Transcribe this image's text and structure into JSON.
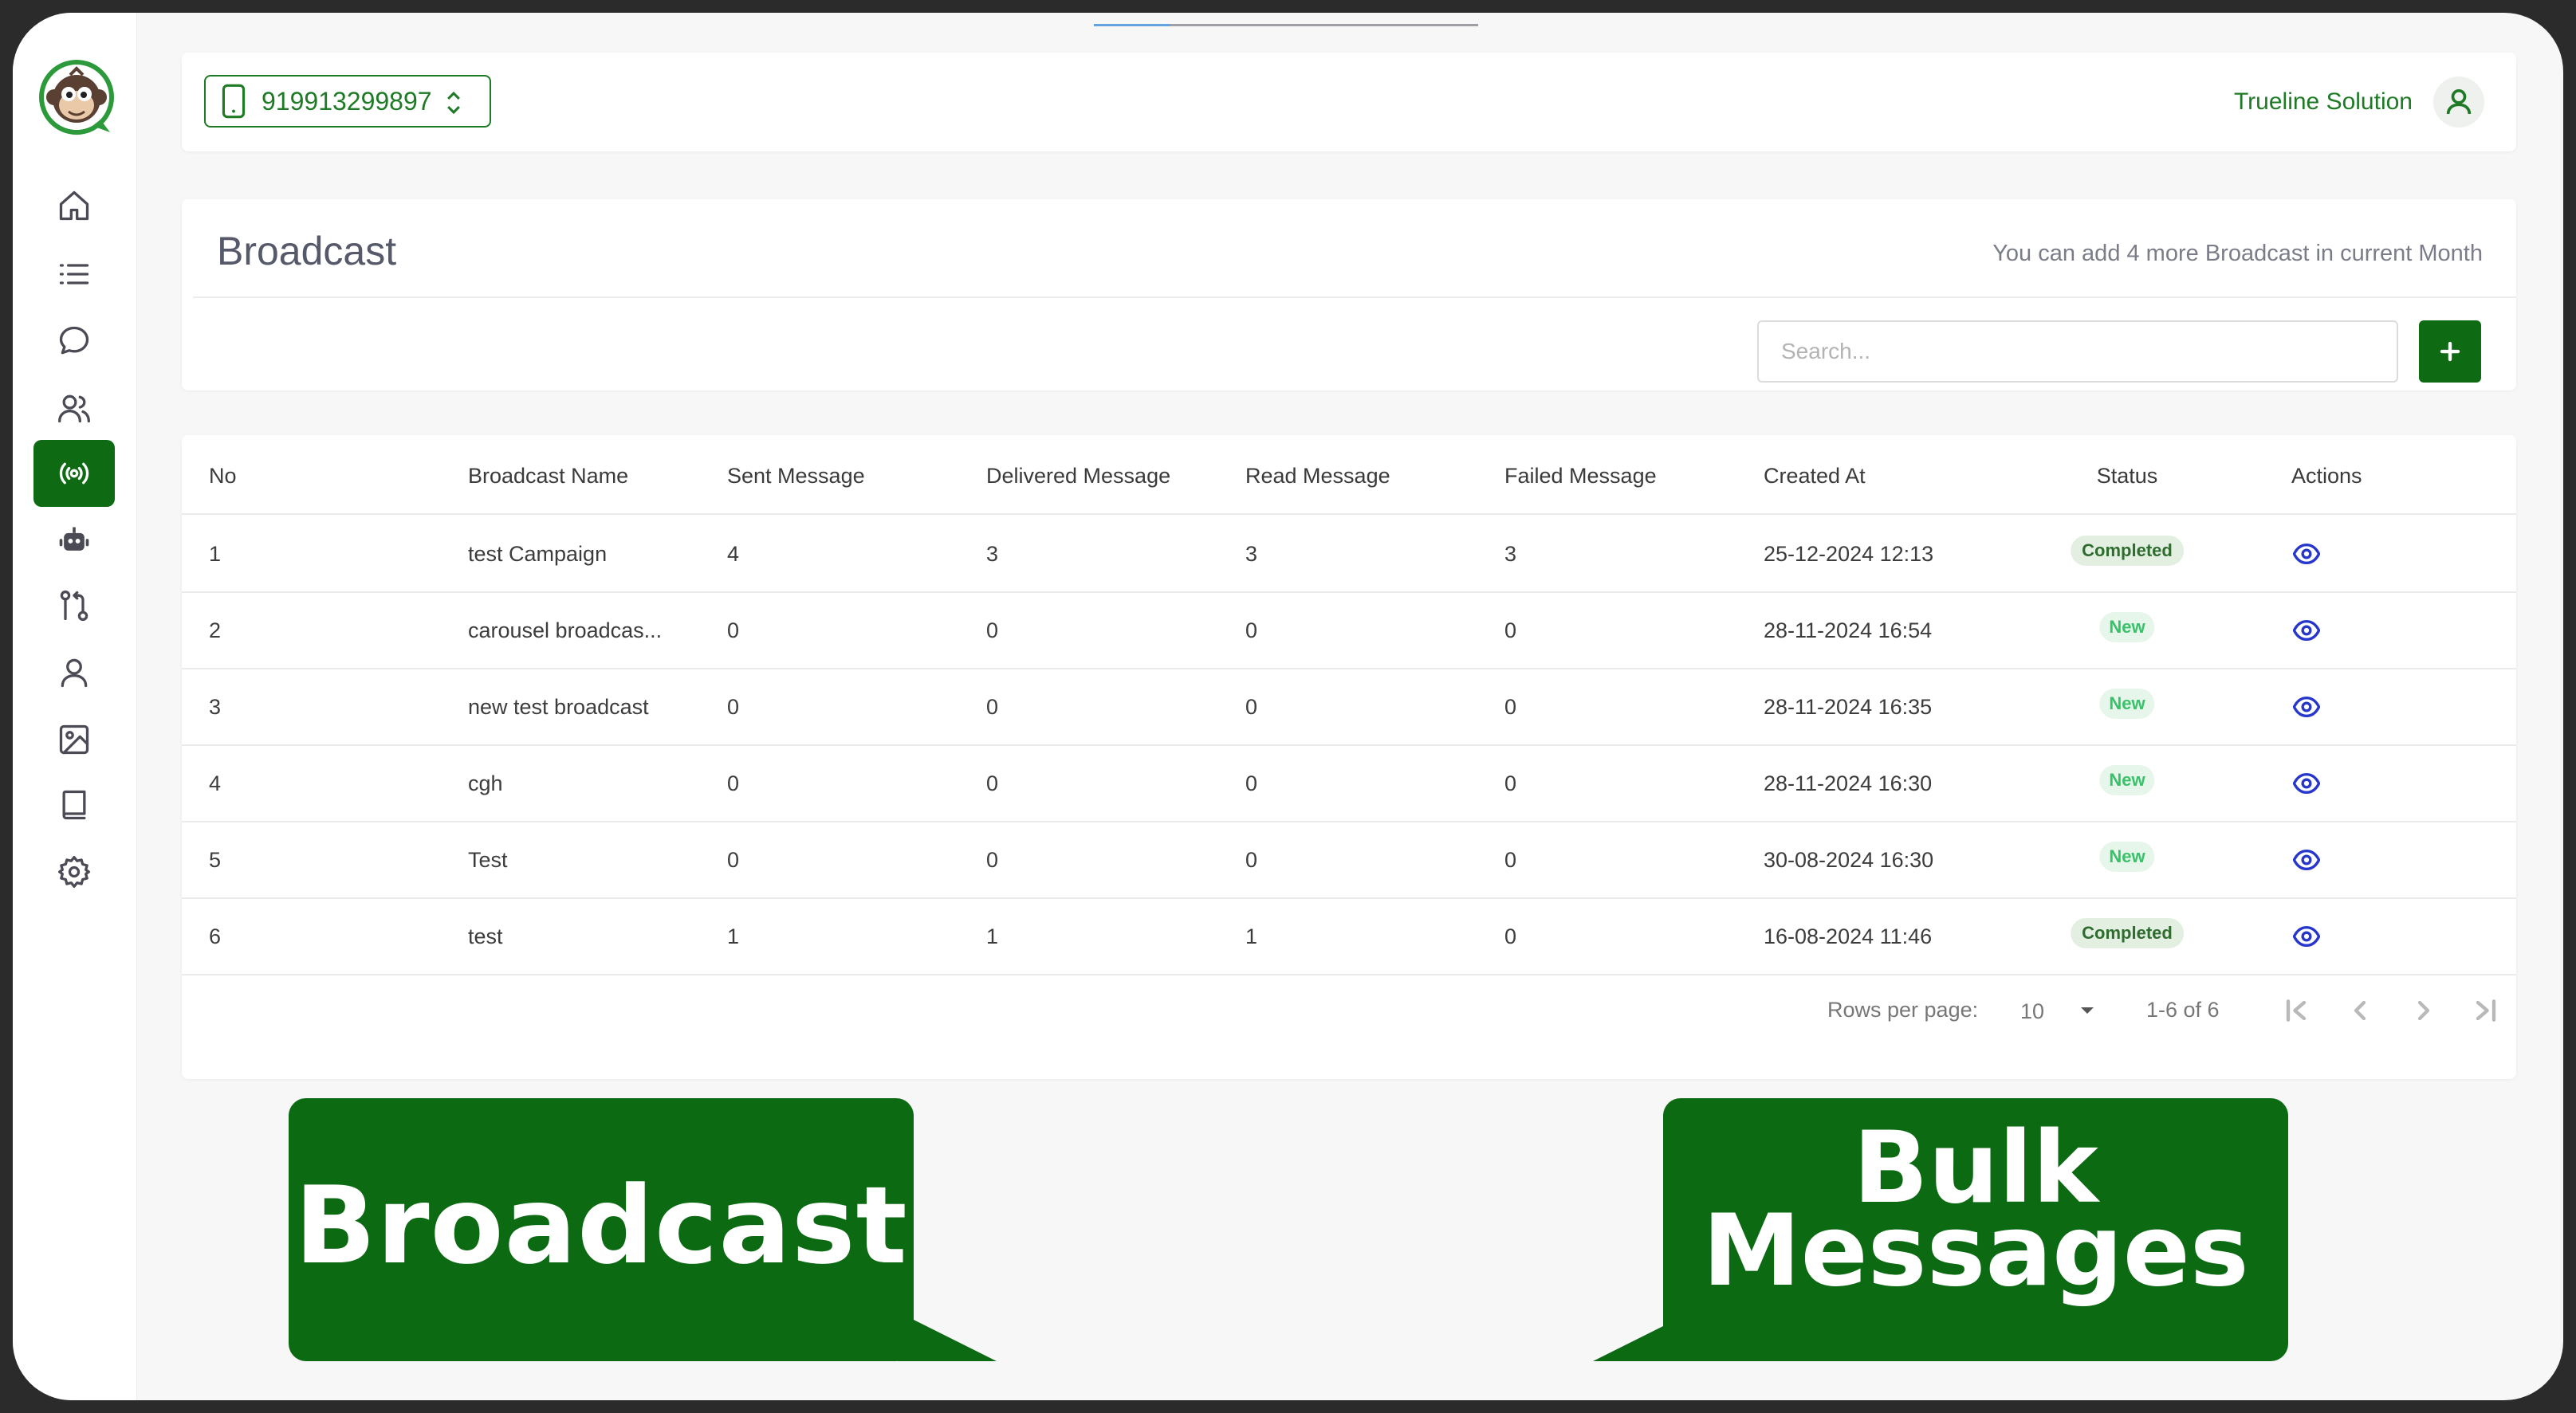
{
  "header": {
    "phone_number": "919913299897",
    "account_name": "Trueline Solution"
  },
  "sidebar": {
    "items": [
      {
        "icon": "home-icon",
        "active": false
      },
      {
        "icon": "list-icon",
        "active": false
      },
      {
        "icon": "chat-icon",
        "active": false
      },
      {
        "icon": "contacts-icon",
        "active": false
      },
      {
        "icon": "broadcast-icon",
        "active": true
      },
      {
        "icon": "bot-icon",
        "active": false
      },
      {
        "icon": "flow-icon",
        "active": false
      },
      {
        "icon": "user-icon",
        "active": false
      },
      {
        "icon": "image-icon",
        "active": false
      },
      {
        "icon": "book-icon",
        "active": false
      },
      {
        "icon": "settings-icon",
        "active": false
      }
    ],
    "active_color": "#0e6b14"
  },
  "panel": {
    "title": "Broadcast",
    "note": "You can add 4 more Broadcast in current Month",
    "search_placeholder": "Search..."
  },
  "table": {
    "columns": [
      "No",
      "Broadcast Name",
      "Sent Message",
      "Delivered Message",
      "Read Message",
      "Failed Message",
      "Created At",
      "Status",
      "Actions"
    ],
    "rows": [
      {
        "no": "1",
        "name": "test Campaign",
        "sent": "4",
        "delivered": "3",
        "read": "3",
        "failed": "3",
        "created": "25-12-2024 12:13",
        "status": "Completed"
      },
      {
        "no": "2",
        "name": "carousel broadcas...",
        "sent": "0",
        "delivered": "0",
        "read": "0",
        "failed": "0",
        "created": "28-11-2024 16:54",
        "status": "New"
      },
      {
        "no": "3",
        "name": "new test broadcast",
        "sent": "0",
        "delivered": "0",
        "read": "0",
        "failed": "0",
        "created": "28-11-2024 16:35",
        "status": "New"
      },
      {
        "no": "4",
        "name": "cgh",
        "sent": "0",
        "delivered": "0",
        "read": "0",
        "failed": "0",
        "created": "28-11-2024 16:30",
        "status": "New"
      },
      {
        "no": "5",
        "name": "Test",
        "sent": "0",
        "delivered": "0",
        "read": "0",
        "failed": "0",
        "created": "30-08-2024 16:30",
        "status": "New"
      },
      {
        "no": "6",
        "name": "test",
        "sent": "1",
        "delivered": "1",
        "read": "1",
        "failed": "0",
        "created": "16-08-2024 11:46",
        "status": "Completed"
      }
    ]
  },
  "pagination": {
    "rows_per_page_label": "Rows per page:",
    "rows_per_page": "10",
    "range": "1-6 of 6"
  },
  "callouts": {
    "left": "Broadcast",
    "right_line1": "Bulk",
    "right_line2": "Messages"
  }
}
